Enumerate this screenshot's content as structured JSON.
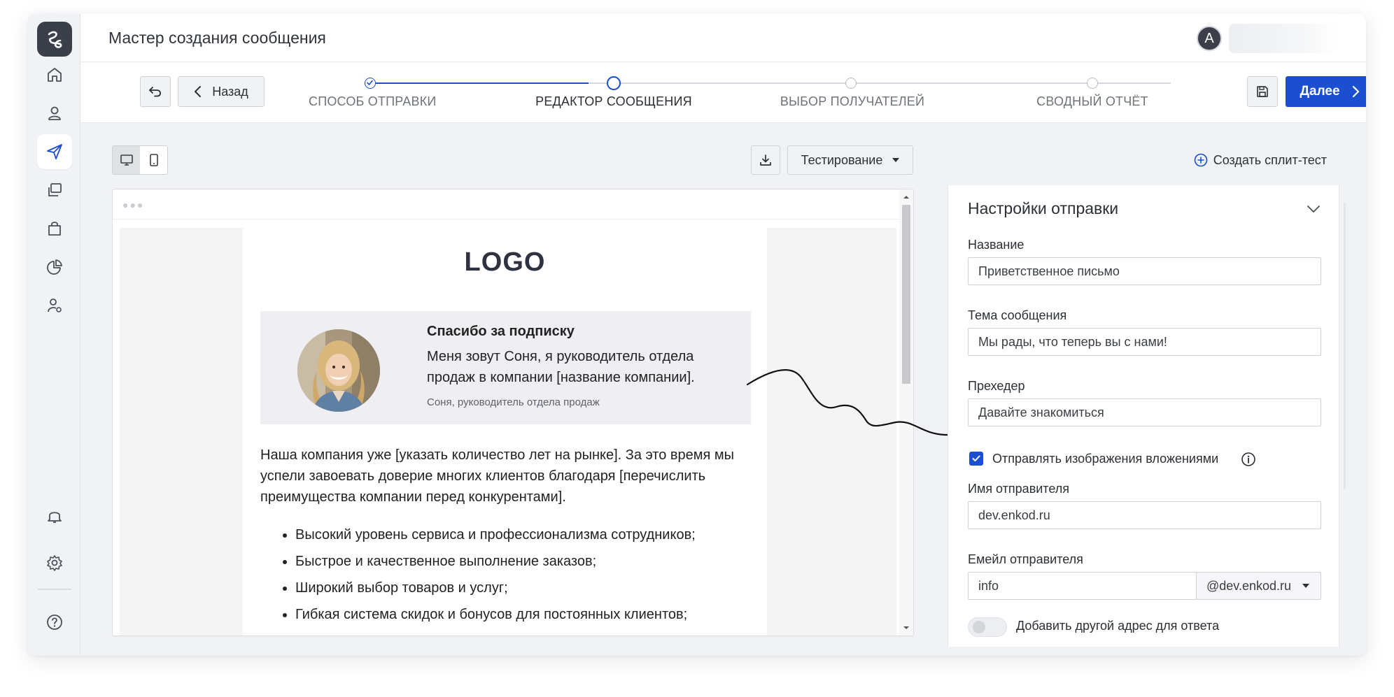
{
  "header": {
    "title": "Мастер создания сообщения",
    "avatar_letter": "A"
  },
  "toolbar": {
    "back_label": "Назад",
    "next_label": "Далее"
  },
  "steps": [
    {
      "label": "СПОСОБ ОТПРАВКИ",
      "status": "done"
    },
    {
      "label": "РЕДАКТОР СООБЩЕНИЯ",
      "status": "current"
    },
    {
      "label": "ВЫБОР ПОЛУЧАТЕЛЕЙ",
      "status": "todo"
    },
    {
      "label": "СВОДНЫЙ ОТЧЁТ",
      "status": "todo"
    }
  ],
  "editor_toolbar": {
    "testing_label": "Тестирование",
    "split_test_label": "Создать сплит-тест"
  },
  "email": {
    "logo_text": "LOGO",
    "card_title": "Спасибо за подписку",
    "card_text": "Меня зовут Соня, я руководитель отдела продаж в компании [название компании].",
    "card_signature": "Соня, руководитель отдела продаж",
    "body_text": "Наша компания уже [указать количество лет на рынке]. За это время мы успели завоевать доверие многих клиентов благодаря [перечислить преимущества компании перед конкурентами].",
    "bullets": [
      "Высокий уровень сервиса и профессионализма сотрудников;",
      "Быстрое и качественное выполнение заказов;",
      "Широкий выбор товаров и услуг;",
      "Гибкая система скидок и бонусов для постоянных клиентов;"
    ]
  },
  "settings": {
    "title": "Настройки отправки",
    "name_label": "Название",
    "name_value": "Приветственное письмо",
    "subject_label": "Тема сообщения",
    "subject_value": "Мы рады, что теперь вы с нами!",
    "preheader_label": "Прехедер",
    "preheader_value": "Давайте знакомиться",
    "attach_images_label": "Отправлять изображения вложениями",
    "attach_images_checked": true,
    "sender_name_label": "Имя отправителя",
    "sender_name_value": "dev.enkod.ru",
    "sender_email_label": "Емейл отправителя",
    "sender_email_value": "info",
    "sender_domain": "@dev.enkod.ru",
    "reply_to_label": "Добавить другой адрес для ответа",
    "reply_to_enabled": false
  },
  "colors": {
    "accent": "#1b4fcf",
    "sidebar_dark": "#3a3f4a",
    "background": "#f1f2f5"
  }
}
